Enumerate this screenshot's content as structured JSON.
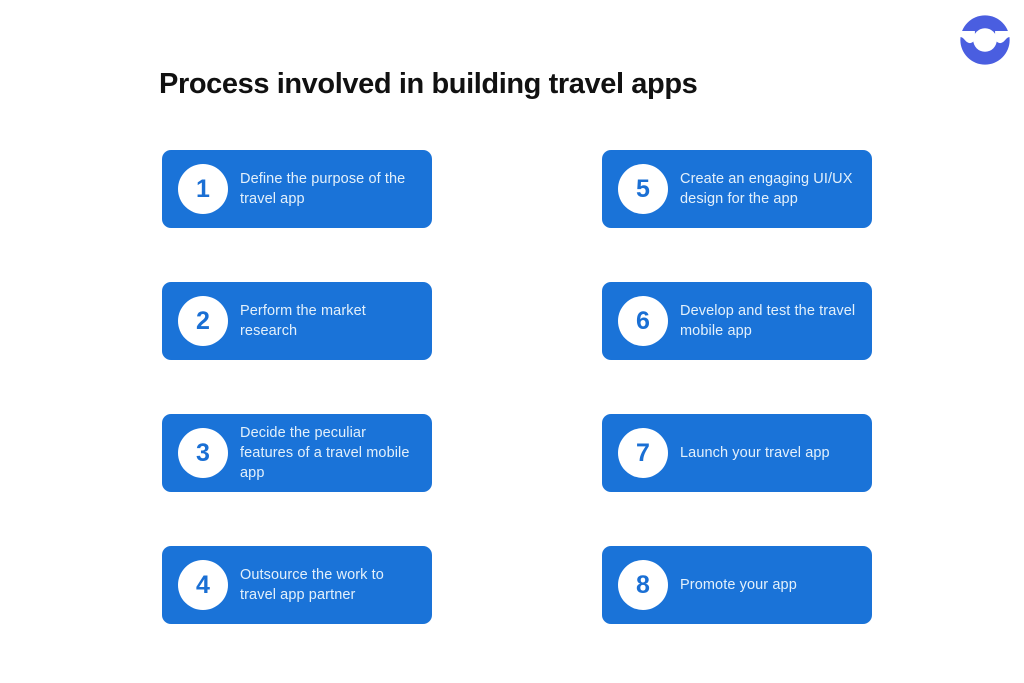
{
  "page": {
    "title": "Process involved in building travel apps",
    "background_color": "#ffffff",
    "title_color": "#111111"
  },
  "logo": {
    "name": "brand-logo",
    "shape": "circle-with-wave-notches",
    "color": "#4a5ee0"
  },
  "theme": {
    "card_color": "#1a73d8",
    "card_text_color": "#e3f0fb",
    "badge_background": "#ffffff",
    "badge_number_color": "#1a6fd4"
  },
  "steps": [
    {
      "number": "1",
      "text": "Define the purpose of the travel app"
    },
    {
      "number": "5",
      "text": "Create an engaging UI/UX design for the app"
    },
    {
      "number": "2",
      "text": "Perform the market research"
    },
    {
      "number": "6",
      "text": "Develop and test the travel mobile app"
    },
    {
      "number": "3",
      "text": "Decide the peculiar features of a travel mobile app"
    },
    {
      "number": "7",
      "text": "Launch your travel app"
    },
    {
      "number": "4",
      "text": "Outsource the work to travel app partner"
    },
    {
      "number": "8",
      "text": "Promote your app"
    }
  ]
}
